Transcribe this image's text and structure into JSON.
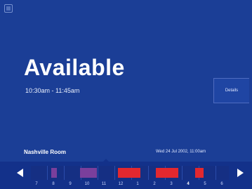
{
  "status": {
    "title": "Available",
    "time_range": "10:30am - 11:45am"
  },
  "details_label": "Details",
  "room_name": "Nashville Room",
  "datetime": "Wed 24 Jul 2002, 11:00am",
  "timeline": {
    "hours": [
      "7",
      "8",
      "9",
      "10",
      "11",
      "12",
      "1",
      "2",
      "3",
      "4",
      "5",
      "6"
    ],
    "current_hour": "4",
    "colors": {
      "busy": "#e3282f",
      "tentative": "#7a3f9c"
    }
  }
}
